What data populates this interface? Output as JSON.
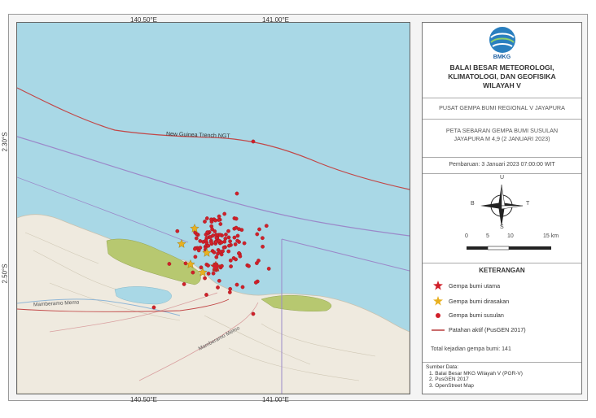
{
  "grid": {
    "lon_top": [
      "140.50°E",
      "141.00°E"
    ],
    "lon_bottom": [
      "140.50°E",
      "141.00°E"
    ],
    "lat_left": [
      "2.30°S",
      "2.50°S"
    ]
  },
  "map": {
    "trench_label": "New Guinea Trench NGT",
    "place_labels": [
      "Mamberamo Memo",
      "Mamberamo Memo"
    ],
    "mainshock_count": 1,
    "felt_count": 5,
    "aftershock_count": 141
  },
  "panel": {
    "logo_text": "BMKG",
    "org_line1": "BALAI BESAR METEOROLOGI,",
    "org_line2": "KLIMATOLOGI, DAN GEOFISIKA",
    "org_line3": "WILAYAH V",
    "center_name": "PUSAT GEMPA BUMI REGIONAL V JAYAPURA",
    "map_title_line1": "PETA SEBARAN GEMPA BUMI SUSULAN",
    "map_title_line2": "JAYAPURA M 4,9 (2 JANUARI 2023)",
    "updated": "Pembaruan: 3 Januari 2023   07:00:00 WIT",
    "compass": {
      "n": "U",
      "s": "S",
      "e": "T",
      "w": "B"
    },
    "scale": {
      "labels": [
        "0",
        "5",
        "10",
        "15 km"
      ]
    },
    "legend_title": "KETERANGAN",
    "legend": [
      {
        "label": "Gempa bumi utama",
        "color": "#d0202a",
        "icon": "red-star"
      },
      {
        "label": "Gempa bumi dirasakan",
        "color": "#e8b020",
        "icon": "yellow-star"
      },
      {
        "label": "Gempa bumi susulan",
        "color": "#d0202a",
        "icon": "red-dot"
      },
      {
        "label": "Patahan aktif (PusGEN 2017)",
        "color": "#b83a3a",
        "icon": "fault-line"
      }
    ],
    "total": "Total kejadian gempa bumi: 141",
    "sources_title": "Sumber Data:",
    "sources": [
      "1. Balai Besar MKG Wilayah V (PGR-V)",
      "2. PusGEN 2017",
      "3. OpenStreet Map"
    ]
  },
  "colors": {
    "sea": "#a9d8e6",
    "land": "#efeadf",
    "hills": "#b7c870",
    "quake_red": "#d0202a",
    "felt_yellow": "#e8b020",
    "fault": "#c24747",
    "boundary": "#9b89c9"
  }
}
